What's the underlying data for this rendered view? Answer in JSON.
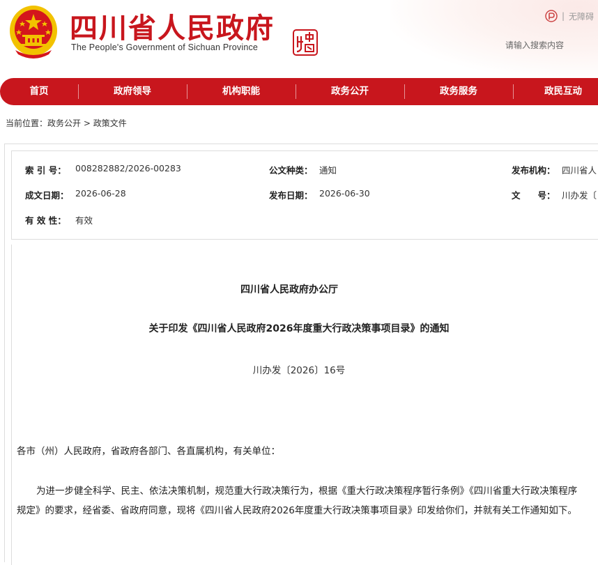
{
  "header": {
    "title": "四川省人民政府",
    "subtitle": "The People's Government of Sichuan Province",
    "a11y_label": "无障碍",
    "search_placeholder": "请输入搜索内容"
  },
  "nav": {
    "items": [
      {
        "label": "首页"
      },
      {
        "label": "政府领导"
      },
      {
        "label": "机构职能"
      },
      {
        "label": "政务公开"
      },
      {
        "label": "政务服务"
      },
      {
        "label": "政民互动"
      }
    ]
  },
  "breadcrumb": {
    "prefix": "当前位置：",
    "level1": "政务公开",
    "separator": ">",
    "level2": "政策文件"
  },
  "meta": {
    "index_label": "索 引 号：",
    "index_value": "008282882/2026-00283",
    "type_label": "公文种类：",
    "type_value": "通知",
    "org_label": "发布机构：",
    "org_value": "四川省人",
    "created_label": "成文日期：",
    "created_value": "2026-06-28",
    "published_label": "发布日期：",
    "published_value": "2026-06-30",
    "docno_label": "文　　号：",
    "docno_value": "川办发〔",
    "valid_label": "有 效 性：",
    "valid_value": "有效"
  },
  "document": {
    "issuer": "四川省人民政府办公厅",
    "title": "关于印发《四川省人民政府2026年度重大行政决策事项目录》的通知",
    "number": "川办发〔2026〕16号",
    "salutation": "各市（州）人民政府，省政府各部门、各直属机构，有关单位：",
    "paragraph1": "为进一步健全科学、民主、依法决策机制，规范重大行政决策行为，根据《重大行政决策程序暂行条例》《四川省重大行政决策程序规定》的要求，经省委、省政府同意，现将《四川省人民政府2026年度重大行政决策事项目录》印发给你们，并就有关工作通知如下。"
  },
  "colors": {
    "brand_red": "#c8161d",
    "gold": "#f2c200"
  }
}
